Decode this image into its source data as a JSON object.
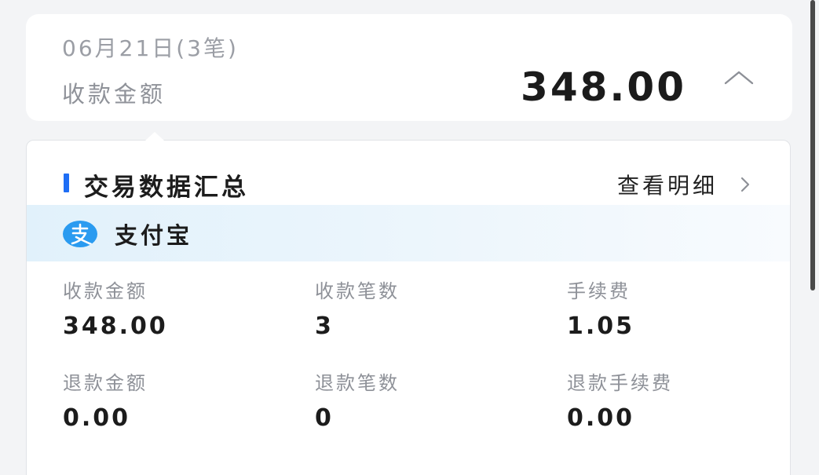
{
  "day_summary": {
    "title": "06月21日(3笔)",
    "label": "收款金额",
    "amount": "348.00",
    "toggle_icon": "chevron-up-icon"
  },
  "summary_panel": {
    "title": "交易数据汇总",
    "detail_link": "查看明细",
    "detail_icon": "chevron-right-icon",
    "accent_color": "#1f6ef5"
  },
  "payment_channel": {
    "name": "支付宝",
    "icon": "alipay-icon",
    "icon_color": "#2a9bf0"
  },
  "stats": [
    {
      "label": "收款金额",
      "value": "348.00"
    },
    {
      "label": "收款笔数",
      "value": "3"
    },
    {
      "label": "手续费",
      "value": "1.05"
    },
    {
      "label": "退款金额",
      "value": "0.00"
    },
    {
      "label": "退款笔数",
      "value": "0"
    },
    {
      "label": "退款手续费",
      "value": "0.00"
    }
  ]
}
